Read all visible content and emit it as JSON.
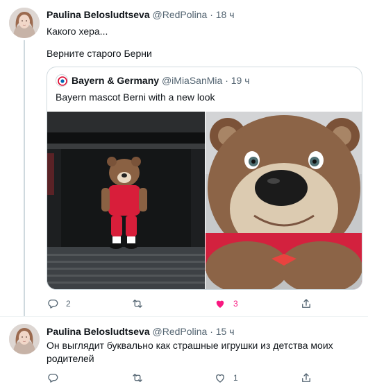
{
  "tweets": [
    {
      "author": "Paulina Belosludtseva",
      "handle": "@RedPolina",
      "dot": "·",
      "time": "18 ч",
      "lines": [
        "Какого хера...",
        "Верните старого Берни"
      ],
      "quoted": {
        "author": "Bayern & Germany",
        "handle": "@iMiaSanMia",
        "dot": "·",
        "time": "19 ч",
        "text": "Bayern mascot Berni with a new look"
      },
      "actions": {
        "replies": "2",
        "retweets": "",
        "likes": "3",
        "liked": true
      }
    },
    {
      "author": "Paulina Belosludtseva",
      "handle": "@RedPolina",
      "dot": "·",
      "time": "15 ч",
      "text": "Он выглядит буквально как страшные игрушки из детства моих родителей",
      "actions": {
        "replies": "",
        "retweets": "",
        "likes": "1",
        "liked": false
      }
    }
  ],
  "colors": {
    "text_primary": "#0f1419",
    "text_secondary": "#536471",
    "like_active": "#f91880",
    "border": "#cfd9de"
  },
  "icons": [
    "reply-icon",
    "retweet-icon",
    "like-icon",
    "share-icon"
  ]
}
